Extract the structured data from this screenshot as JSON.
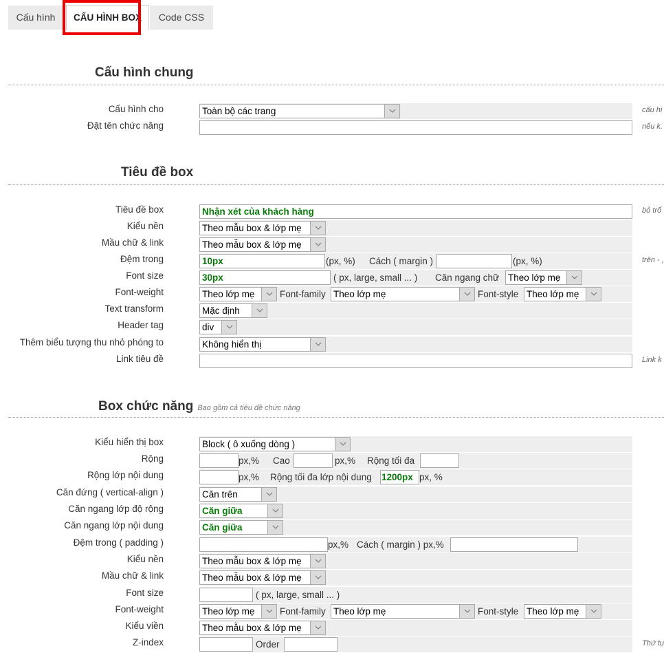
{
  "tabs": [
    {
      "label": "Cấu hình",
      "active": false
    },
    {
      "label": "CẤU HÌNH BOX",
      "active": true
    },
    {
      "label": "Code CSS",
      "active": false
    }
  ],
  "highlight_color": "#ee0000",
  "sections": {
    "general": {
      "title": "Cấu hình chung",
      "rows": {
        "config_for": {
          "label": "Cấu hình cho",
          "value": "Toàn bộ các trang",
          "note": "cấu hi"
        },
        "function_name": {
          "label": "Đặt tên chức năng",
          "value": "",
          "note": "nếu k."
        }
      }
    },
    "box_title": {
      "title": "Tiêu đề box",
      "rows": {
        "title": {
          "label": "Tiêu đề box",
          "value": "Nhận xét của khách hàng",
          "note": "bỏ trố"
        },
        "background": {
          "label": "Kiểu nền",
          "value": "Theo mẫu box & lớp mẹ"
        },
        "text_color": {
          "label": "Mầu chữ & link",
          "value": "Theo mẫu box & lớp mẹ"
        },
        "padding": {
          "label": "Đệm trong",
          "value": "10px",
          "unit": "(px, %)",
          "margin_label": "Cách ( margin )",
          "margin_value": "",
          "margin_unit": "(px, %)",
          "note": "trên - ,"
        },
        "font_size": {
          "label": "Font size",
          "value": "30px",
          "unit": "( px, large, small ... )",
          "align_label": "Căn ngang chữ",
          "align_value": "Theo lớp mẹ"
        },
        "font_weight": {
          "label": "Font-weight",
          "value": "Theo lớp mẹ",
          "family_label": "Font-family",
          "family_value": "Theo lớp mẹ",
          "style_label": "Font-style",
          "style_value": "Theo lớp mẹ"
        },
        "text_transform": {
          "label": "Text transform",
          "value": "Mặc định"
        },
        "header_tag": {
          "label": "Header tag",
          "value": "div"
        },
        "toggle_icon": {
          "label": "Thêm biểu tượng thu nhỏ phóng to",
          "value": "Không hiển thị"
        },
        "title_link": {
          "label": "Link tiêu đề",
          "value": "",
          "note": "Link k"
        }
      }
    },
    "function_box": {
      "title": "Box chức năng",
      "subtitle": "Bao gồm cả tiêu đề chức năng",
      "rows": {
        "display": {
          "label": "Kiểu hiển thị box",
          "value": "Block ( ô xuống dòng )"
        },
        "width": {
          "label": "Rộng",
          "value": "",
          "unit": "px,%",
          "height_label": "Cao",
          "height_value": "",
          "height_unit": "px,%",
          "max_label": "Rộng tối đa",
          "max_value": ""
        },
        "content_width": {
          "label": "Rộng lớp nội dung",
          "value": "",
          "unit": "px,%",
          "max_label": "Rộng tối đa lớp nội dung",
          "max_value": "1200px",
          "max_unit": "px, %"
        },
        "vertical_align": {
          "label": "Căn đứng ( vertical-align )",
          "value": "Căn trên"
        },
        "width_align": {
          "label": "Căn ngang lớp độ rộng",
          "value": "Căn giữa"
        },
        "content_align": {
          "label": "Căn ngang lớp nội dung",
          "value": "Căn giữa"
        },
        "padding": {
          "label": "Đệm trong ( padding )",
          "value": "",
          "unit": "px,%",
          "margin_label": "Cách ( margin ) px,%",
          "margin_value": ""
        },
        "background": {
          "label": "Kiểu nền",
          "value": "Theo mẫu box & lớp mẹ"
        },
        "text_color": {
          "label": "Mầu chữ & link",
          "value": "Theo mẫu box & lớp mẹ"
        },
        "font_size": {
          "label": "Font size",
          "value": "",
          "unit": "( px, large, small ... )"
        },
        "font_weight": {
          "label": "Font-weight",
          "value": "Theo lớp mẹ",
          "family_label": "Font-family",
          "family_value": "Theo lớp mẹ",
          "style_label": "Font-style",
          "style_value": "Theo lớp mẹ"
        },
        "border": {
          "label": "Kiểu viền",
          "value": "Theo mẫu box & lớp mẹ"
        },
        "z_index": {
          "label": "Z-index",
          "value": "",
          "order_label": "Order",
          "order_value": "",
          "note": "Thứ tự"
        }
      }
    }
  }
}
